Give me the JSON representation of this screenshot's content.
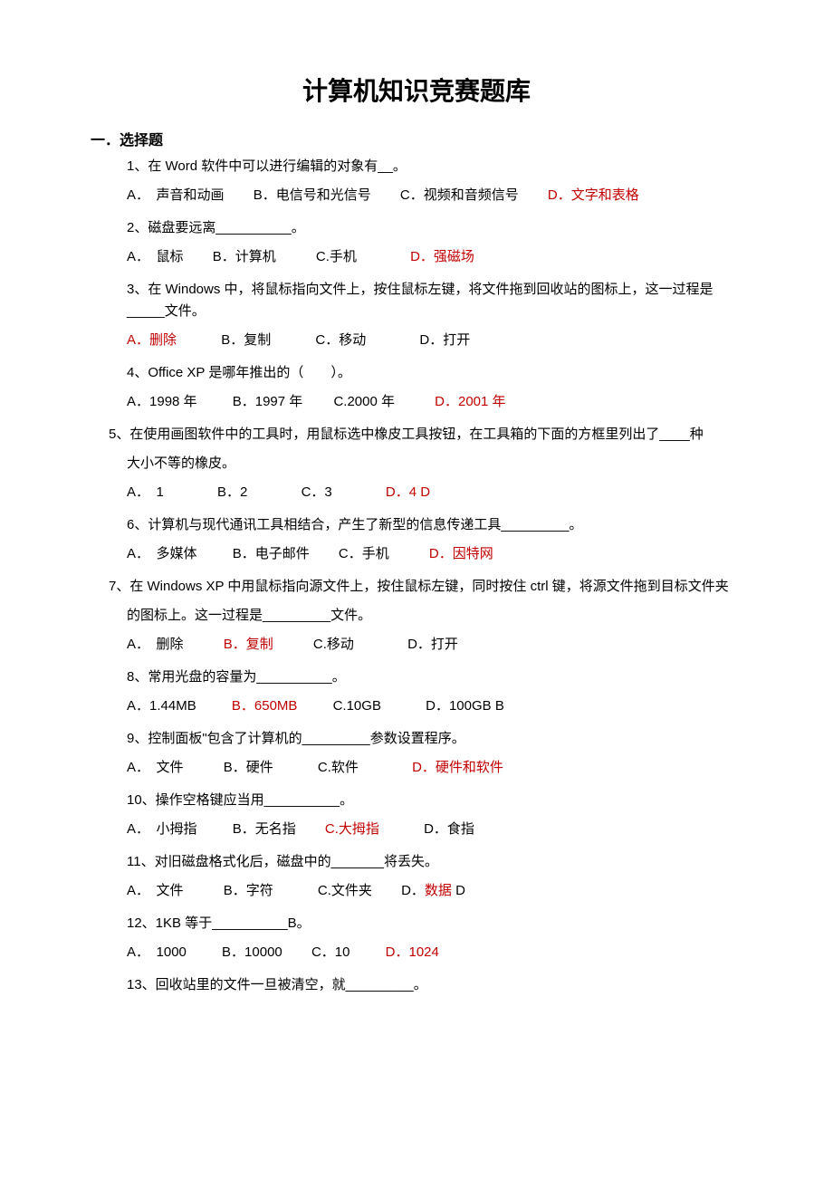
{
  "title": "计算机知识竞赛题库",
  "section_header": "一．选择题",
  "q1": {
    "text": "1、在 Word 软件中可以进行编辑的对象有__。",
    "a": "A．　声音和动画",
    "b": "B．电信号和光信号",
    "c": "C．视频和音频信号",
    "d": "D．文字和表格"
  },
  "q2": {
    "text": "2、磁盘要远离__________。",
    "a": "A．　鼠标",
    "b": "B．计算机",
    "c": "C.手机",
    "d": "D．强磁场"
  },
  "q3": {
    "text": "3、在 Windows 中，将鼠标指向文件上，按住鼠标左键，将文件拖到回收站的图标上，这一过程是_____文件。",
    "a": "A．删除",
    "b": "B．复制",
    "c": "C．移动",
    "d": "D．打开"
  },
  "q4": {
    "text": "4、Office XP 是哪年推出的（　　）。",
    "a": "A．1998 年",
    "b": "B．1997 年",
    "c": "C.2000 年",
    "d": "D．2001 年"
  },
  "q5": {
    "text": "5、在使用画图软件中的工具时，用鼠标选中橡皮工具按钮，在工具箱的下面的方框里列出了____种",
    "text2": "大小不等的橡皮。",
    "a": "A．　1",
    "b": "B．2",
    "c": "C．3",
    "d": "D．4 D"
  },
  "q6": {
    "text": "6、计算机与现代通讯工具相结合，产生了新型的信息传递工具_________。",
    "a": "A．　多媒体",
    "b": "B．电子邮件",
    "c": "C．手机",
    "d": "D．因特网"
  },
  "q7": {
    "text": "7、在 Windows XP 中用鼠标指向源文件上，按住鼠标左键，同时按住 ctrl 键，将源文件拖到目标文件夹",
    "text2": "的图标上。这一过程是_________文件。",
    "a": "A．　删除",
    "b": "B．复制",
    "c": "C.移动",
    "d": "D．打开"
  },
  "q8": {
    "text": "8、常用光盘的容量为__________。",
    "a": "A．1.44MB",
    "b": "B．650MB",
    "c": "C.10GB",
    "d": "D．100GB B"
  },
  "q9": {
    "text": "9、控制面板\"包含了计算机的_________参数设置程序。",
    "a": "A．　文件",
    "b": "B．硬件",
    "c": "C.软件",
    "d": "D．硬件和软件"
  },
  "q10": {
    "text": "10、操作空格键应当用__________。",
    "a": "A．　小拇指",
    "b": "B．无名指",
    "c": "C.大拇指",
    "d": "D．食指"
  },
  "q11": {
    "text": "11、对旧磁盘格式化后，磁盘中的_______将丢失。",
    "a": "A．　文件",
    "b": "B．字符",
    "c": "C.文件夹",
    "d_prefix": "D．",
    "d_answer": "数据",
    "d_suffix": " D"
  },
  "q12": {
    "text": "12、1KB 等于__________B。",
    "a": "A．　1000",
    "b": "B．10000",
    "c": "C．10",
    "d": "D．1024"
  },
  "q13": {
    "text": "13、回收站里的文件一旦被清空，就_________。"
  }
}
